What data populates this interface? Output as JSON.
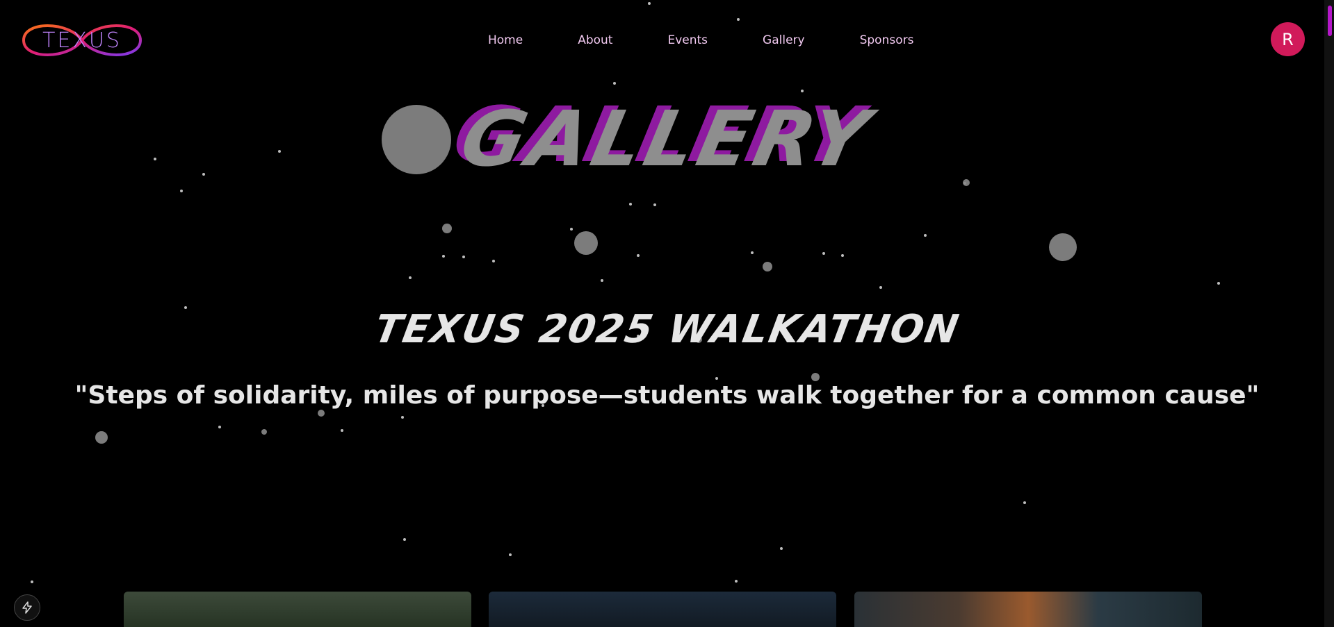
{
  "nav": {
    "logo_text": "TEXUS",
    "links": [
      "Home",
      "About",
      "Events",
      "Gallery",
      "Sponsors"
    ],
    "avatar_initial": "R"
  },
  "hero": {
    "title": "GALLERY",
    "event_title": "TEXUS 2025 WALKATHON",
    "tagline": "\"Steps of solidarity, miles of purpose—students walk together for a common cause\""
  },
  "colors": {
    "background": "#000000",
    "nav_text": "#f0c8ef",
    "avatar": "#d11a5a",
    "title_shadow": "#8e1aa0",
    "scroll_thumb": "#b517c9"
  },
  "icons": {
    "dev_tools": "lightning-icon"
  }
}
